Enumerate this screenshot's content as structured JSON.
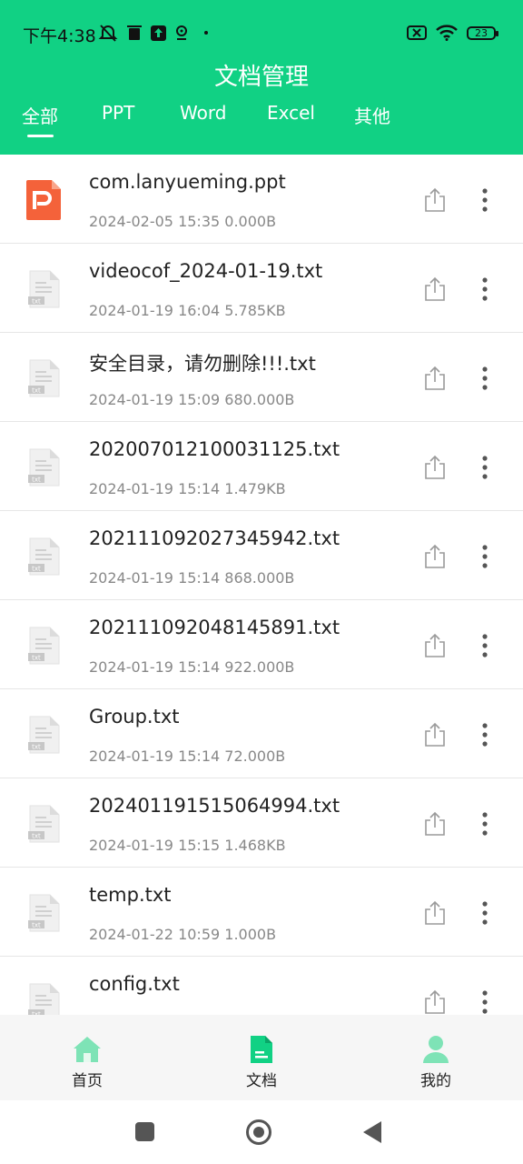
{
  "status_bar": {
    "time": "下午4:38",
    "battery": "23"
  },
  "header": {
    "title": "文档管理"
  },
  "tabs": [
    "全部",
    "PPT",
    "Word",
    "Excel",
    "其他"
  ],
  "files": [
    {
      "name": "com.lanyueming.ppt",
      "meta": "2024-02-05 15:35 0.000B",
      "type": "ppt"
    },
    {
      "name": "videocof_2024-01-19.txt",
      "meta": "2024-01-19 16:04 5.785KB",
      "type": "txt"
    },
    {
      "name": "安全目录，请勿删除!!!.txt",
      "meta": "2024-01-19 15:09 680.000B",
      "type": "txt"
    },
    {
      "name": "202007012100031125.txt",
      "meta": "2024-01-19 15:14 1.479KB",
      "type": "txt"
    },
    {
      "name": "202111092027345942.txt",
      "meta": "2024-01-19 15:14 868.000B",
      "type": "txt"
    },
    {
      "name": "202111092048145891.txt",
      "meta": "2024-01-19 15:14 922.000B",
      "type": "txt"
    },
    {
      "name": "Group.txt",
      "meta": "2024-01-19 15:14 72.000B",
      "type": "txt"
    },
    {
      "name": "202401191515064994.txt",
      "meta": "2024-01-19 15:15 1.468KB",
      "type": "txt"
    },
    {
      "name": "temp.txt",
      "meta": "2024-01-22 10:59 1.000B",
      "type": "txt"
    },
    {
      "name": "config.txt",
      "meta": "",
      "type": "txt"
    }
  ],
  "file_icon_label": "txt",
  "bottom_nav": [
    {
      "label": "首页",
      "icon": "home-icon"
    },
    {
      "label": "文档",
      "icon": "document-icon"
    },
    {
      "label": "我的",
      "icon": "profile-icon"
    }
  ],
  "colors": {
    "accent": "#11d184",
    "ppt": "#f4623a"
  }
}
